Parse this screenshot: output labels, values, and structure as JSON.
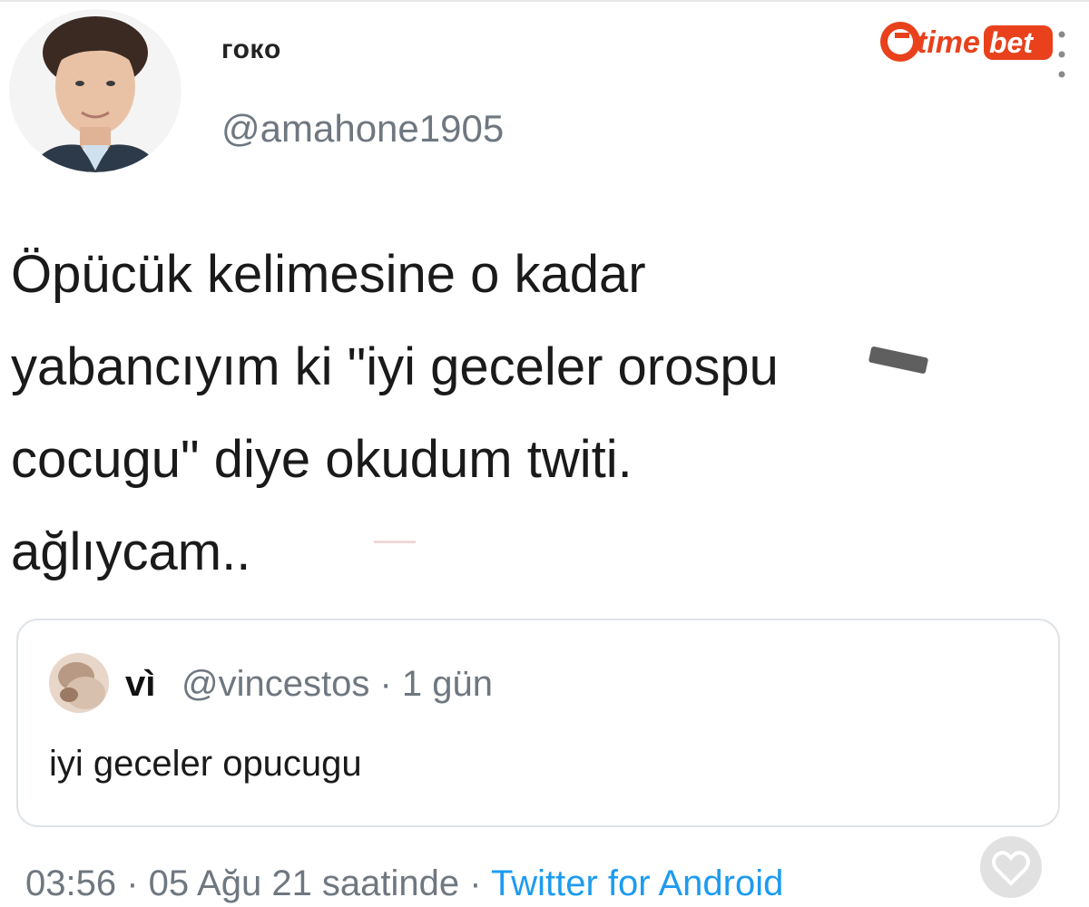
{
  "tweet": {
    "author": {
      "display_name": "гокo",
      "handle": "@amahone1905"
    },
    "text": "Öpücük kelimesine o kadar\nyabancıyım ki  \"iyi geceler orospu\ncocugu\" diye okudum twiti.\nağlıycam..",
    "quoted": {
      "name": "vì",
      "handle": "@vincestos",
      "separator": " · ",
      "age": "1 gün",
      "text": "iyi geceler opucugu"
    },
    "footer": {
      "timestamp": "03:56 · 05 Ağu 21 saatinde",
      "separator": " · ",
      "source": "Twitter for Android"
    }
  },
  "watermark": {
    "brand_text": "timebet",
    "brand_color": "#e8411c"
  },
  "colors": {
    "text_primary": "#1a1a1a",
    "text_secondary": "#6f7780",
    "link": "#1d9bf0",
    "card_border": "#dfe3e7"
  },
  "icons": [
    "avatar-photo",
    "timebet-logo",
    "more-dots-icon",
    "heart-icon"
  ]
}
